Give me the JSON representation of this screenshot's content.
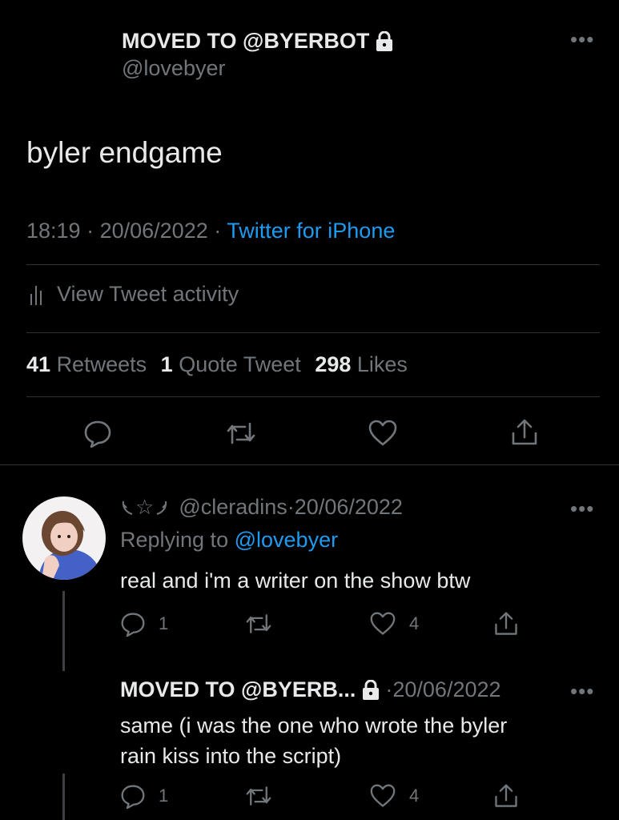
{
  "main_tweet": {
    "display_name": "MOVED TO @BYERBOT",
    "handle": "@lovebyer",
    "text": "byler endgame",
    "time": "18:19",
    "date": "20/06/2022",
    "source": "Twitter for iPhone",
    "activity_label": "View Tweet activity",
    "stats": {
      "retweets_count": "41",
      "retweets_label": "Retweets",
      "quotes_count": "1",
      "quotes_label": "Quote Tweet",
      "likes_count": "298",
      "likes_label": "Likes"
    }
  },
  "reply1": {
    "emoji_name": "☆",
    "handle": "@cleradins",
    "date": "20/06/2022",
    "replying_label": "Replying to",
    "replying_handle": "@lovebyer",
    "text": "real and i'm a writer on the show btw",
    "reply_count": "1",
    "like_count": "4"
  },
  "reply2": {
    "display_name": "MOVED TO @BYERB...",
    "date": "20/06/2022",
    "text_line1": "same (i was the one who wrote the byler",
    "text_line2": "rain kiss into the script)",
    "reply_count": "1",
    "like_count": "4"
  },
  "colors": {
    "background": "#000000",
    "accent": "#1d9bf0",
    "muted": "#71767b",
    "text": "#e7e9ea"
  }
}
